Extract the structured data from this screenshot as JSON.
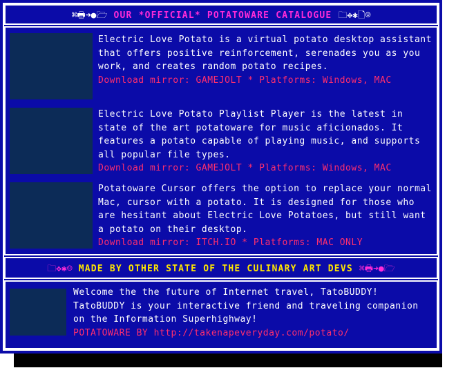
{
  "catalogue": {
    "header": {
      "left_symbols": "⌘🖶➜●🗁",
      "title": "OUR *OFFICIAL* POTATOWARE CATALOGUE",
      "right_symbols": "🗀✥✱🗋☺"
    },
    "items": [
      {
        "description": "Electric Love Potato is a virtual potato desktop assistant that offers positive reinforcement, serenades you as you work, and creates random potato recipes.",
        "meta": "Download mirror: GAMEJOLT  *  Platforms: Windows, MAC"
      },
      {
        "description": "Electric Love Potato Playlist Player is the latest in state of the art potatoware for music aficionados. It features a potato capable of playing music, and supports all popular file types.",
        "meta": "Download mirror: GAMEJOLT  *  Platforms: Windows, MAC"
      },
      {
        "description": "Potatoware Cursor offers the option to replace your normal Mac, cursor with a potato. It is designed for those who are hesitant about Electric Love Potatoes, but still want a potato on their desktop.",
        "meta": "Download mirror: ITCH.IO  *  Platforms: MAC ONLY"
      }
    ]
  },
  "others": {
    "header": {
      "left_symbols": "🗀✥✱☺",
      "title": "MADE BY OTHER STATE OF THE CULINARY ART DEVS",
      "right_symbols": "⌘🖶➜●🗁"
    },
    "item": {
      "description": "Welcome the the future of Internet travel, TatoBUDDY! TatoBUDDY is your interactive friend and traveling companion on the Information Superhighway!",
      "meta": "POTATOWARE BY http://takenapeveryday.com/potato/"
    }
  },
  "colors": {
    "background": "#0b0ba8",
    "thumbnail": "#0c2b57",
    "header_pink": "#ff2bd8",
    "header_yellow": "#ffe600",
    "meta_red": "#ff2e6e",
    "text": "#ffffff"
  }
}
